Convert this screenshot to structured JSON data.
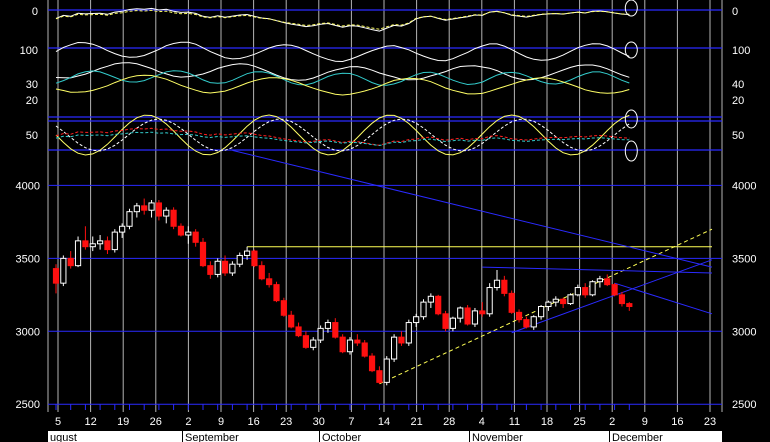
{
  "chart_data": {
    "type": "candlestick",
    "colors": {
      "background": "#000000",
      "grid_horizontal": "#2a2aff",
      "grid_vertical": "#b4b4b4",
      "candle_up": "#ffffff",
      "candle_down": "#ff1010",
      "trend_blue": "#2a2aff",
      "trend_yellow": "#ffff55",
      "indicator_white": "#ffffff",
      "indicator_yellow": "#ffff66",
      "indicator_cyan": "#33cccc",
      "indicator_red": "#ff2020",
      "month_band": "#ffffff",
      "month_text": "#000000"
    },
    "x_ticks": [
      "5",
      "12",
      "19",
      "26",
      "2",
      "9",
      "16",
      "23",
      "30",
      "7",
      "14",
      "21",
      "28",
      "4",
      "11",
      "18",
      "25",
      "2",
      "9",
      "16",
      "23"
    ],
    "months": [
      "ugust",
      "September",
      "October",
      "November",
      "December"
    ],
    "price_axis": {
      "ticks": [
        4000,
        3500,
        3000,
        2500
      ],
      "range": [
        2440,
        4140
      ]
    },
    "indicator_axes": {
      "panel1_left": [
        "0",
        "100",
        "30",
        "20"
      ],
      "panel1_right": [
        "0",
        "100",
        "40",
        "20"
      ],
      "panel2_left": [
        "50"
      ],
      "panel2_right": [
        "50"
      ]
    },
    "candles": [
      [
        3430,
        3460,
        3260,
        3330
      ],
      [
        3330,
        3520,
        3310,
        3500
      ],
      [
        3500,
        3550,
        3430,
        3450
      ],
      [
        3450,
        3650,
        3440,
        3620
      ],
      [
        3620,
        3720,
        3560,
        3580
      ],
      [
        3580,
        3650,
        3550,
        3600
      ],
      [
        3600,
        3660,
        3560,
        3620
      ],
      [
        3620,
        3650,
        3530,
        3560
      ],
      [
        3560,
        3700,
        3540,
        3680
      ],
      [
        3680,
        3740,
        3640,
        3720
      ],
      [
        3720,
        3840,
        3700,
        3820
      ],
      [
        3820,
        3880,
        3780,
        3860
      ],
      [
        3860,
        3910,
        3800,
        3830
      ],
      [
        3830,
        3900,
        3780,
        3880
      ],
      [
        3880,
        3900,
        3760,
        3790
      ],
      [
        3790,
        3850,
        3740,
        3830
      ],
      [
        3830,
        3850,
        3700,
        3720
      ],
      [
        3720,
        3740,
        3650,
        3660
      ],
      [
        3660,
        3720,
        3600,
        3680
      ],
      [
        3680,
        3700,
        3580,
        3610
      ],
      [
        3610,
        3640,
        3440,
        3450
      ],
      [
        3450,
        3480,
        3360,
        3390
      ],
      [
        3390,
        3500,
        3370,
        3480
      ],
      [
        3480,
        3520,
        3380,
        3400
      ],
      [
        3400,
        3480,
        3380,
        3460
      ],
      [
        3460,
        3540,
        3440,
        3520
      ],
      [
        3520,
        3580,
        3490,
        3550
      ],
      [
        3550,
        3560,
        3440,
        3450
      ],
      [
        3450,
        3480,
        3350,
        3360
      ],
      [
        3360,
        3400,
        3300,
        3320
      ],
      [
        3320,
        3340,
        3200,
        3210
      ],
      [
        3210,
        3230,
        3100,
        3110
      ],
      [
        3110,
        3140,
        3020,
        3030
      ],
      [
        3030,
        3060,
        2960,
        2970
      ],
      [
        2970,
        3000,
        2880,
        2890
      ],
      [
        2890,
        2960,
        2870,
        2940
      ],
      [
        2940,
        3040,
        2920,
        3020
      ],
      [
        3020,
        3080,
        2990,
        3060
      ],
      [
        3060,
        3090,
        2950,
        2960
      ],
      [
        2960,
        2980,
        2850,
        2860
      ],
      [
        2860,
        2960,
        2840,
        2940
      ],
      [
        2940,
        2980,
        2900,
        2920
      ],
      [
        2920,
        2940,
        2820,
        2830
      ],
      [
        2830,
        2850,
        2720,
        2730
      ],
      [
        2730,
        2760,
        2640,
        2650
      ],
      [
        2650,
        2830,
        2630,
        2810
      ],
      [
        2810,
        2980,
        2790,
        2960
      ],
      [
        2960,
        3000,
        2900,
        2920
      ],
      [
        2920,
        3080,
        2900,
        3060
      ],
      [
        3060,
        3120,
        3030,
        3100
      ],
      [
        3100,
        3220,
        3080,
        3200
      ],
      [
        3200,
        3260,
        3160,
        3240
      ],
      [
        3240,
        3250,
        3110,
        3120
      ],
      [
        3120,
        3140,
        3000,
        3020
      ],
      [
        3020,
        3100,
        3000,
        3090
      ],
      [
        3090,
        3170,
        3060,
        3160
      ],
      [
        3160,
        3180,
        3040,
        3050
      ],
      [
        3050,
        3160,
        3030,
        3140
      ],
      [
        3140,
        3200,
        3100,
        3120
      ],
      [
        3120,
        3330,
        3100,
        3300
      ],
      [
        3300,
        3420,
        3280,
        3350
      ],
      [
        3350,
        3380,
        3240,
        3260
      ],
      [
        3260,
        3280,
        3120,
        3130
      ],
      [
        3130,
        3150,
        3060,
        3080
      ],
      [
        3080,
        3100,
        3020,
        3030
      ],
      [
        3030,
        3110,
        3010,
        3100
      ],
      [
        3100,
        3180,
        3080,
        3170
      ],
      [
        3170,
        3210,
        3140,
        3200
      ],
      [
        3200,
        3240,
        3170,
        3220
      ],
      [
        3220,
        3230,
        3160,
        3190
      ],
      [
        3190,
        3260,
        3180,
        3250
      ],
      [
        3250,
        3320,
        3240,
        3300
      ],
      [
        3300,
        3330,
        3230,
        3250
      ],
      [
        3250,
        3350,
        3240,
        3340
      ],
      [
        3340,
        3380,
        3300,
        3360
      ],
      [
        3360,
        3390,
        3310,
        3320
      ],
      [
        3320,
        3330,
        3240,
        3250
      ],
      [
        3250,
        3270,
        3170,
        3190
      ],
      [
        3190,
        3200,
        3140,
        3170
      ]
    ]
  }
}
